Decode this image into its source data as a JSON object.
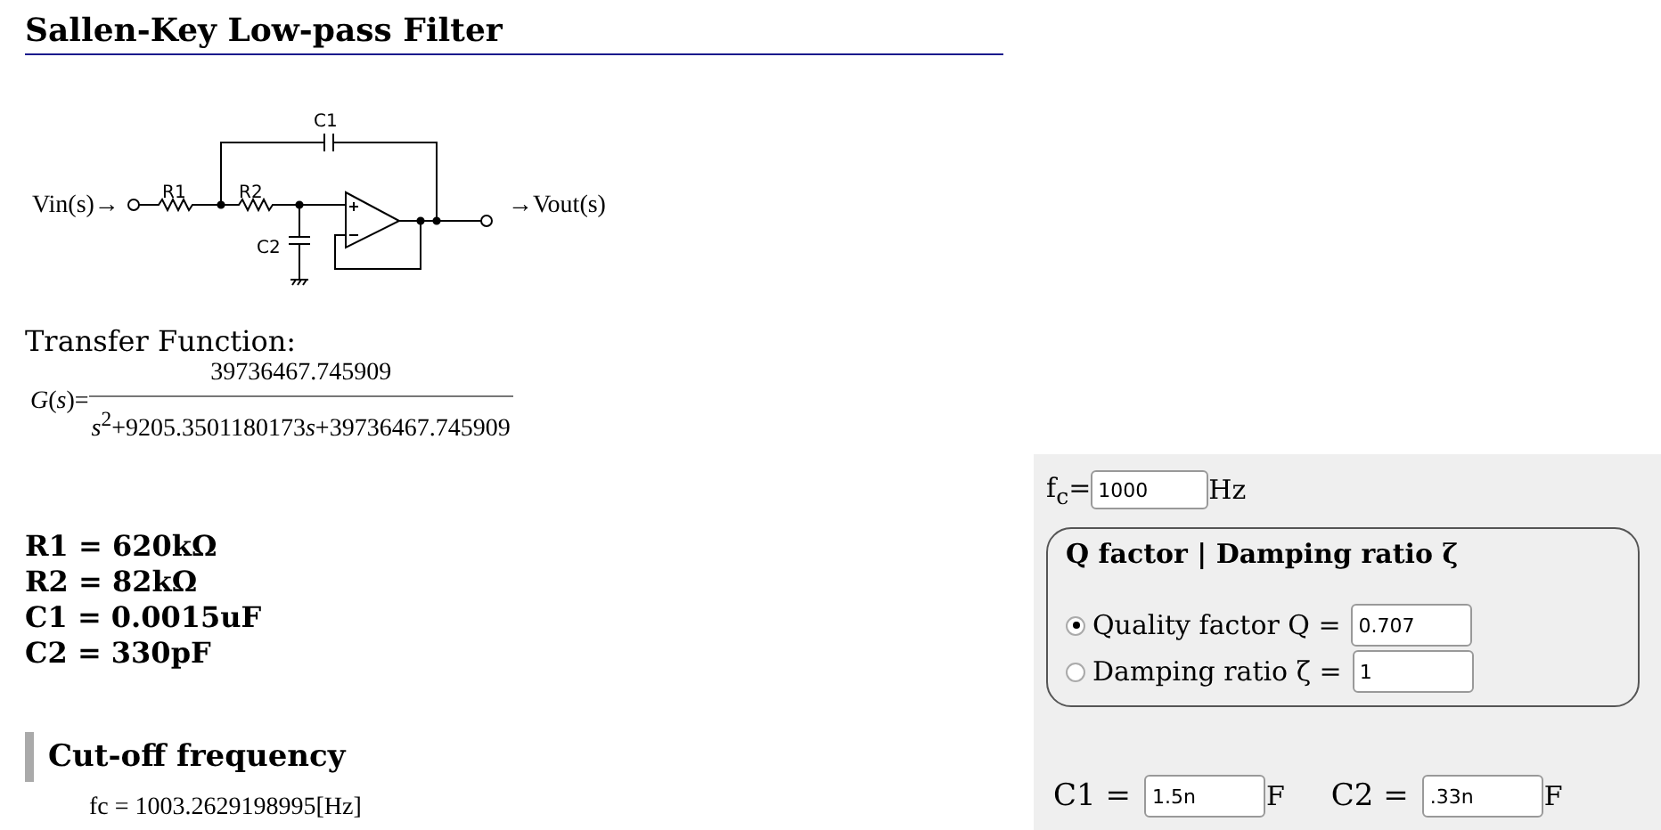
{
  "title": "Sallen-Key Low-pass Filter",
  "circuit": {
    "input_label": "Vin(s)→",
    "output_label": "→Vout(s)",
    "components": [
      "R1",
      "R2",
      "C1",
      "C2"
    ]
  },
  "transfer_function": {
    "heading": "Transfer Function:",
    "lhs": "*G*(*s*)=",
    "numerator": "39736467.745909",
    "denominator": [
      {
        "kind": "var",
        "text": "s"
      },
      {
        "kind": "sup",
        "text": "2"
      },
      {
        "kind": "num",
        "text": "+9205.3501180173"
      },
      {
        "kind": "var",
        "text": "s"
      },
      {
        "kind": "num",
        "text": "+39736467.745909"
      }
    ]
  },
  "values": [
    "R1 = 620kΩ",
    "R2 = 82kΩ",
    "C1 = 0.0015uF",
    "C2 = 330pF"
  ],
  "cutoff": {
    "heading": "Cut-off frequency",
    "result": "fc = 1003.2629198995[Hz]"
  },
  "form": {
    "fc_label": "f$_{c}$=",
    "fc_value": "1000",
    "fc_unit": "Hz",
    "mode_group": {
      "title": "Q factor | Damping ratio ζ",
      "options": [
        {
          "label": "Quality factor Q =",
          "value": "0.707",
          "selected": true
        },
        {
          "label": "Damping ratio ζ =",
          "value": "1",
          "selected": false
        }
      ]
    },
    "capacitors": [
      {
        "label": "C1 =",
        "value": "1.5n",
        "unit": "F"
      },
      {
        "label": "C2 =",
        "value": ".33n",
        "unit": "F"
      }
    ]
  }
}
